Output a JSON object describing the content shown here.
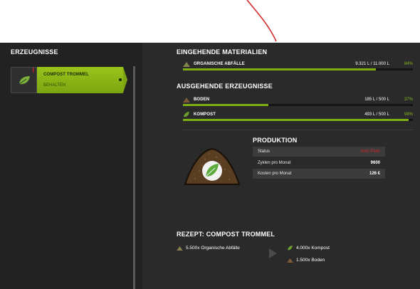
{
  "left_panel": {
    "title": "ERZEUGNISSE",
    "products": [
      {
        "name": "COMPOST TROMMEL",
        "status": "BEHALTEN",
        "icon": "leaf-icon",
        "alert": "!"
      }
    ]
  },
  "right_panel": {
    "incoming_title": "EINGEHENDE MATERIALIEN",
    "incoming": [
      {
        "name": "ORGANISCHE ABFÄLLE",
        "amount": "9.321 L / 11.000 L",
        "percent": "84%",
        "fill": 0.84,
        "icon": "organic-waste-icon"
      }
    ],
    "outgoing_title": "AUSGEHENDE ERZEUGNISSE",
    "outgoing": [
      {
        "name": "BODEN",
        "amount": "185 L / 500 L",
        "percent": "37%",
        "fill": 0.37,
        "icon": "soil-icon"
      },
      {
        "name": "KOMPOST",
        "amount": "493 L / 500 L",
        "percent": "98%",
        "fill": 0.98,
        "icon": "compost-icon"
      }
    ],
    "production": {
      "title": "PRODUKTION",
      "rows": [
        {
          "label": "Status",
          "value": "Kein Platz"
        },
        {
          "label": "Zyklen pro Monat",
          "value": "9600"
        },
        {
          "label": "Kosten pro Monat",
          "value": "126 €"
        }
      ]
    },
    "recipe": {
      "title": "REZEPT: COMPOST TROMMEL",
      "inputs": [
        {
          "text": "5.500x Organische Abfälle",
          "icon": "organic-waste-icon"
        }
      ],
      "outputs": [
        {
          "text": "4.000x Kompost",
          "icon": "compost-icon"
        },
        {
          "text": "1.500x Boden",
          "icon": "soil-icon"
        }
      ]
    }
  },
  "colors": {
    "accent_green": "#87b823",
    "alert_red": "#d12626",
    "panel_bg": "#2a2a2a"
  }
}
